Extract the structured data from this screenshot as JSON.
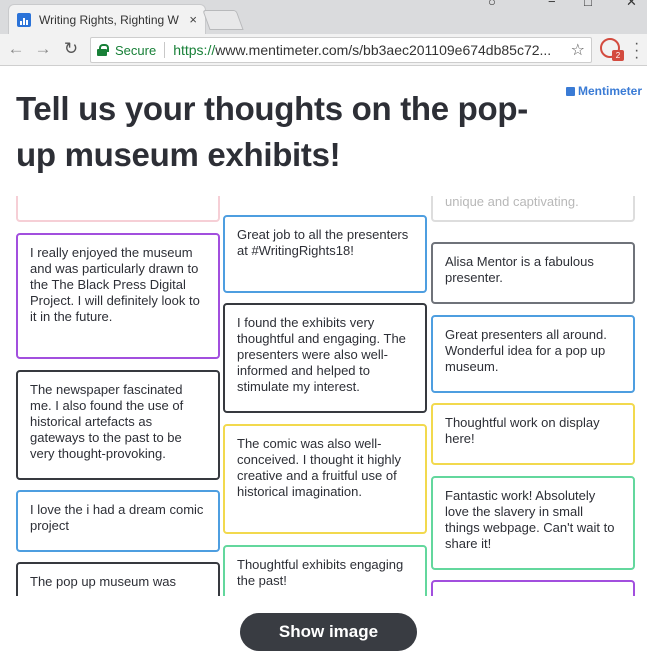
{
  "browser": {
    "tab_title": "Writing Rights, Righting W",
    "tab_close": "×",
    "secure_label": "Secure",
    "url_scheme": "https://",
    "url_rest": "www.mentimeter.com/s/bb3aec201109e674db85c72...",
    "extension_badge": "2"
  },
  "brand": {
    "name": "Mentimeter",
    "color": "#3a7bd5"
  },
  "question": {
    "title": "Tell us your thoughts on the pop-up museum exhibits!"
  },
  "responses": {
    "col1": [
      {
        "text": "",
        "color": "#f6cfd6"
      },
      {
        "text": "I really enjoyed the museum and was particularly drawn to the The Black Press Digital Project. I will definitely look to it in the future.",
        "color": "#a24fde"
      },
      {
        "text": "The newspaper fascinated me. I also found the use of historical artefacts as gateways to the past to be very thought-provoking.",
        "color": "#36393f"
      },
      {
        "text": "I love the i had a dream comic project",
        "color": "#4e9ee0"
      },
      {
        "text": "The pop up museum was",
        "color": "#36393f"
      }
    ],
    "col2": [
      {
        "text": "Great job to all the presenters at #WritingRights18!",
        "color": "#4e9ee0"
      },
      {
        "text": "I found the exhibits very thoughtful and engaging. The presenters were also well-informed and helped to stimulate my interest.",
        "color": "#36393f"
      },
      {
        "text": "The comic was also well-conceived. I thought it highly creative and a fruitful use of historical imagination.",
        "color": "#f2d94e"
      },
      {
        "text": "Thoughtful exhibits engaging the past!",
        "color": "#63d79d"
      }
    ],
    "col3": [
      {
        "text": "unique and captivating.",
        "color": "#dddddd"
      },
      {
        "text": "Alisa Mentor is a fabulous presenter.",
        "color": "#6f737a"
      },
      {
        "text": "Great presenters all around. Wonderful idea for a pop up museum.",
        "color": "#4e9ee0"
      },
      {
        "text": "Thoughtful work on display here!",
        "color": "#f2d94e"
      },
      {
        "text": "Fantastic work! Absolutely love the slavery in small things webpage. Can't wait to share it!",
        "color": "#63d79d"
      },
      {
        "text": "",
        "color": "#a24fde"
      }
    ]
  },
  "actions": {
    "show_image_label": "Show image"
  }
}
